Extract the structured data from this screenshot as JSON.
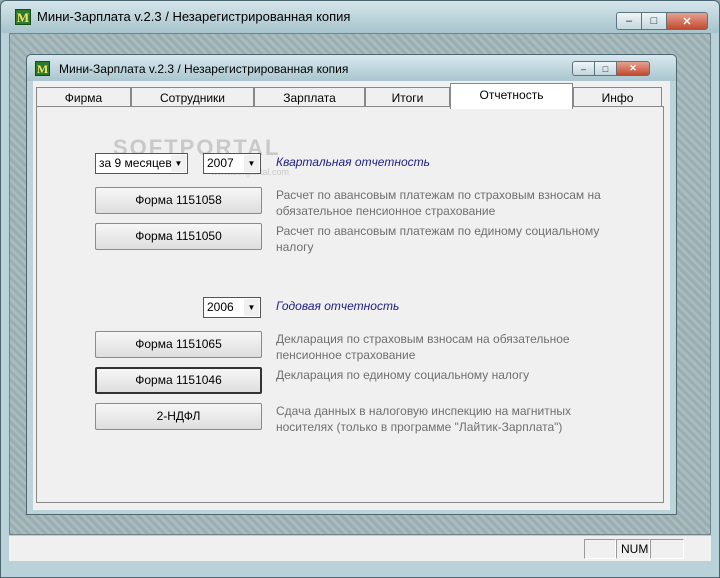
{
  "outer_window": {
    "title": "Мини-Зарплата v.2.3 / Незарегистрированная копия",
    "icon_letter": "М"
  },
  "inner_window": {
    "title": "Мини-Зарплата v.2.3 / Незарегистрированная копия",
    "icon_letter": "М"
  },
  "window_controls": {
    "minimize": "–",
    "maximize": "□",
    "close": "✕"
  },
  "tabs": [
    {
      "label": "Фирма"
    },
    {
      "label": "Сотрудники"
    },
    {
      "label": "Зарплата"
    },
    {
      "label": "Итоги"
    },
    {
      "label": "Отчетность",
      "active": true
    },
    {
      "label": "Инфо"
    }
  ],
  "watermark": {
    "text": "SOFTPORTAL",
    "sub": "www.softportal.com"
  },
  "quarterly": {
    "period_value": "за 9 месяцев",
    "year_value": "2007",
    "label": "Квартальная отчетность",
    "items": [
      {
        "button": "Форма 1151058",
        "description": "Расчет по авансовым платежам по страховым взносам на обязательное пенсионное страхование"
      },
      {
        "button": "Форма 1151050",
        "description": "Расчет по авансовым платежам по единому социальному налогу"
      }
    ]
  },
  "annual": {
    "year_value": "2006",
    "label": "Годовая отчетность",
    "items": [
      {
        "button": "Форма 1151065",
        "description": "Декларация  по страховым взносам на обязательное пенсионное страхование"
      },
      {
        "button": "Форма 1151046",
        "description": "Декларация по единому социальному налогу"
      },
      {
        "button": "2-НДФЛ",
        "description": "Сдача данных в налоговую инспекцию на магнитных носителях (только в программе \"Лайтик-Зарплата\")"
      }
    ]
  },
  "statusbar": {
    "num": "NUM"
  },
  "colors": {
    "section_label": "#1d1d8a",
    "description": "#6f6f6f"
  }
}
